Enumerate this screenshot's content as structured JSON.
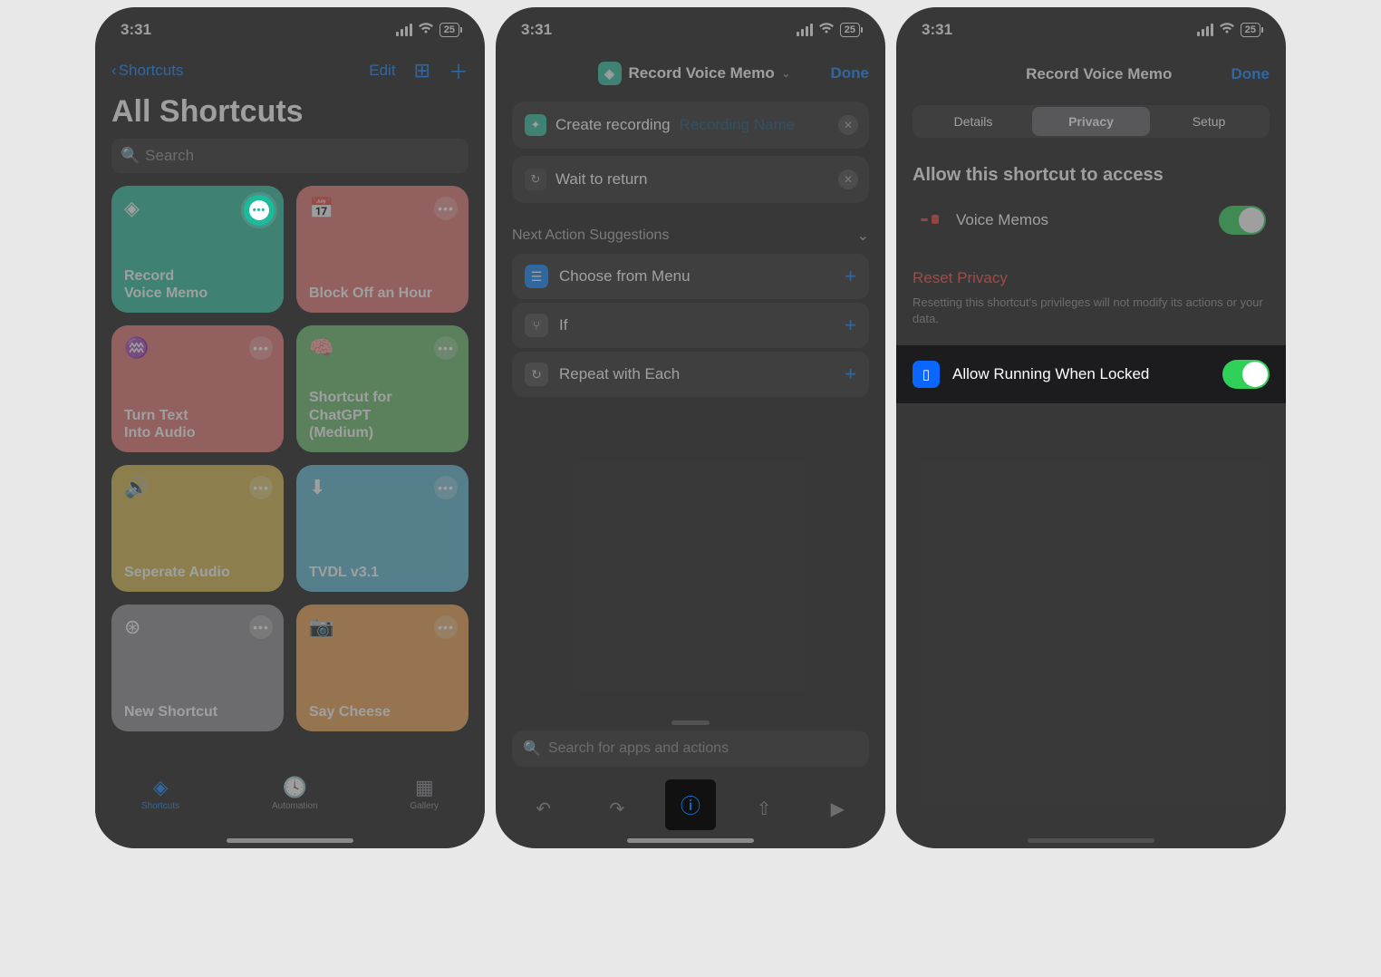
{
  "status": {
    "time": "3:31",
    "battery": "25"
  },
  "screen1": {
    "back": "Shortcuts",
    "edit": "Edit",
    "title": "All Shortcuts",
    "search_placeholder": "Search",
    "tiles": [
      {
        "label": "Record\nVoice Memo",
        "color": "teal",
        "icon": "layers"
      },
      {
        "label": "Block Off an Hour",
        "color": "red",
        "icon": "calendar-plus"
      },
      {
        "label": "Turn Text\nInto Audio",
        "color": "salmon",
        "icon": "waveform"
      },
      {
        "label": "Shortcut for\nChatGPT\n(Medium)",
        "color": "green",
        "icon": "brain"
      },
      {
        "label": "Seperate Audio",
        "color": "yellow",
        "icon": "speaker"
      },
      {
        "label": "TVDL v3.1",
        "color": "cyan",
        "icon": "download"
      },
      {
        "label": "New Shortcut",
        "color": "gray",
        "icon": "bolt-circle"
      },
      {
        "label": "Say Cheese",
        "color": "orange",
        "icon": "camera"
      },
      {
        "label": "",
        "color": "blue",
        "icon": "drop"
      },
      {
        "label": "",
        "color": "purple",
        "icon": "layers"
      }
    ],
    "tabs": [
      "Shortcuts",
      "Automation",
      "Gallery"
    ]
  },
  "screen2": {
    "title": "Record Voice Memo",
    "done": "Done",
    "action1_text": "Create recording",
    "action1_hint": "Recording Name",
    "action2_text": "Wait to return",
    "suggestions_header": "Next Action Suggestions",
    "suggestions": [
      {
        "label": "Choose from Menu",
        "icon": "menu",
        "blue": true
      },
      {
        "label": "If",
        "icon": "branch",
        "blue": false
      },
      {
        "label": "Repeat with Each",
        "icon": "repeat",
        "blue": false
      }
    ],
    "search_placeholder": "Search for apps and actions"
  },
  "screen3": {
    "title": "Record Voice Memo",
    "done": "Done",
    "segments": [
      "Details",
      "Privacy",
      "Setup"
    ],
    "allow_header": "Allow this shortcut to access",
    "access_app": "Voice Memos",
    "reset": "Reset Privacy",
    "reset_note": "Resetting this shortcut's privileges will not modify its actions or your data.",
    "locked_label": "Allow Running When Locked"
  }
}
